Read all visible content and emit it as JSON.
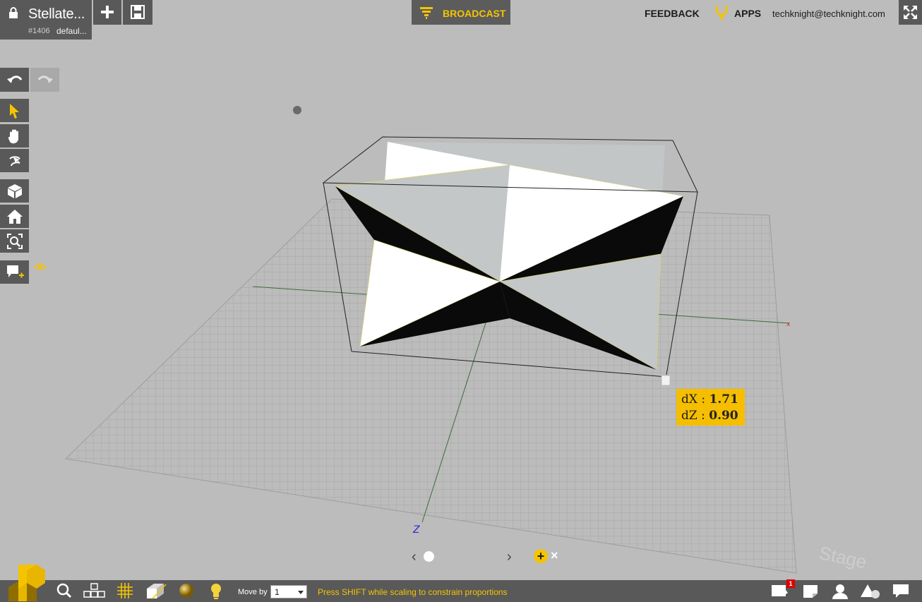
{
  "document": {
    "title": "Stellate...",
    "id": "#1406",
    "branch": "defaul..."
  },
  "header": {
    "broadcast_label": "BROADCAST",
    "feedback_label": "FEEDBACK",
    "apps_label": "APPS",
    "user_email": "techknight@techknight.com"
  },
  "viewport": {
    "measure": {
      "dx_label": "dX :",
      "dx_value": "1.71",
      "dz_label": "dZ :",
      "dz_value": "0.90"
    },
    "axis_label": "Z",
    "watermark": "Stage"
  },
  "pager": {
    "prev": "‹",
    "next": "›",
    "add": "+",
    "close": "×"
  },
  "bottombar": {
    "moveby_label": "Move by",
    "moveby_value": "1",
    "hint": "Press SHIFT while scaling to constrain proportions",
    "notification_count": "1"
  },
  "colors": {
    "accent": "#f5c400",
    "panel": "#595959",
    "background": "#bcbcbc"
  },
  "icons": [
    "lock-icon",
    "plus-icon",
    "save-icon",
    "broadcast-icon",
    "plug-icon",
    "fullscreen-icon",
    "undo-icon",
    "redo-icon",
    "pointer-icon",
    "hand-icon",
    "orbit-icon",
    "cube-icon",
    "home-icon",
    "zoom-fit-icon",
    "note-add-icon",
    "eye-icon",
    "logo-icon",
    "search-icon",
    "blocks-icon",
    "grid-icon",
    "box-icon",
    "material-icon",
    "light-icon",
    "comment-icon",
    "sticky-note-icon",
    "user-icon",
    "shapes-icon",
    "chat-icon"
  ]
}
